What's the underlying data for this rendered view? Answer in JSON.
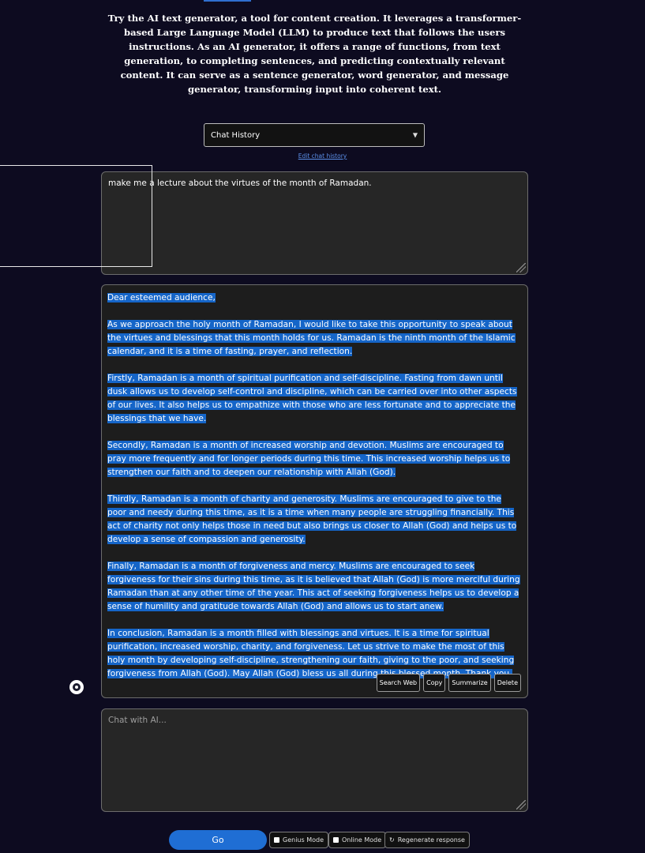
{
  "intro": {
    "text": "Try the AI text generator, a tool for content creation. It leverages a transformer-based Large Language Model (LLM) to produce text that follows the users instructions. As an AI generator, it offers a range of functions, from text generation, to completing sentences, and predicting contextually relevant content. It can serve as a sentence generator, word generator, and message generator, transforming input into coherent text."
  },
  "history": {
    "selected": "Chat History",
    "edit_link": "Edit chat history"
  },
  "prompt": {
    "text": "make me a lecture about the virtues of the month of Ramadan."
  },
  "response": {
    "paragraphs": [
      "Dear esteemed audience,",
      "As we approach the holy month of Ramadan, I would like to take this opportunity to speak about the virtues and blessings that this month holds for us. Ramadan is the ninth month of the Islamic calendar, and it is a time of fasting, prayer, and reflection.",
      "Firstly, Ramadan is a month of spiritual purification and self-discipline. Fasting from dawn until dusk allows us to develop self-control and discipline, which can be carried over into other aspects of our lives. It also helps us to empathize with those who are less fortunate and to appreciate the blessings that we have.",
      "Secondly, Ramadan is a month of increased worship and devotion. Muslims are encouraged to pray more frequently and for longer periods during this time. This increased worship helps us to strengthen our faith and to deepen our relationship with Allah (God).",
      "Thirdly, Ramadan is a month of charity and generosity. Muslims are encouraged to give to the poor and needy during this time, as it is a time when many people are struggling financially. This act of charity not only helps those in need but also brings us closer to Allah (God) and helps us to develop a sense of compassion and generosity.",
      "Finally, Ramadan is a month of forgiveness and mercy. Muslims are encouraged to seek forgiveness for their sins during this time, as it is believed that Allah (God) is more merciful during Ramadan than at any other time of the year. This act of seeking forgiveness helps us to develop a sense of humility and gratitude towards Allah (God) and allows us to start anew.",
      "In conclusion, Ramadan is a month filled with blessings and virtues. It is a time for spiritual purification, increased worship, charity, and forgiveness. Let us strive to make the most of this holy month by developing self-discipline, strengthening our faith, giving to the poor, and seeking forgiveness from Allah (God). May Allah (God) bless us all during this blessed month. Thank you."
    ],
    "actions": {
      "search_web": "Search Web",
      "copy": "Copy",
      "summarize": "Summarize",
      "delete": "Delete"
    }
  },
  "chat": {
    "placeholder": "Chat with AI..."
  },
  "controls": {
    "go": "Go",
    "genius_mode": "Genius Mode",
    "online_mode": "Online Mode",
    "regenerate": "Regenerate response",
    "regenerate_icon": "↻"
  },
  "colors": {
    "background": "#0d0b20",
    "accent": "#1f6ed4",
    "selection": "#1565c8"
  }
}
